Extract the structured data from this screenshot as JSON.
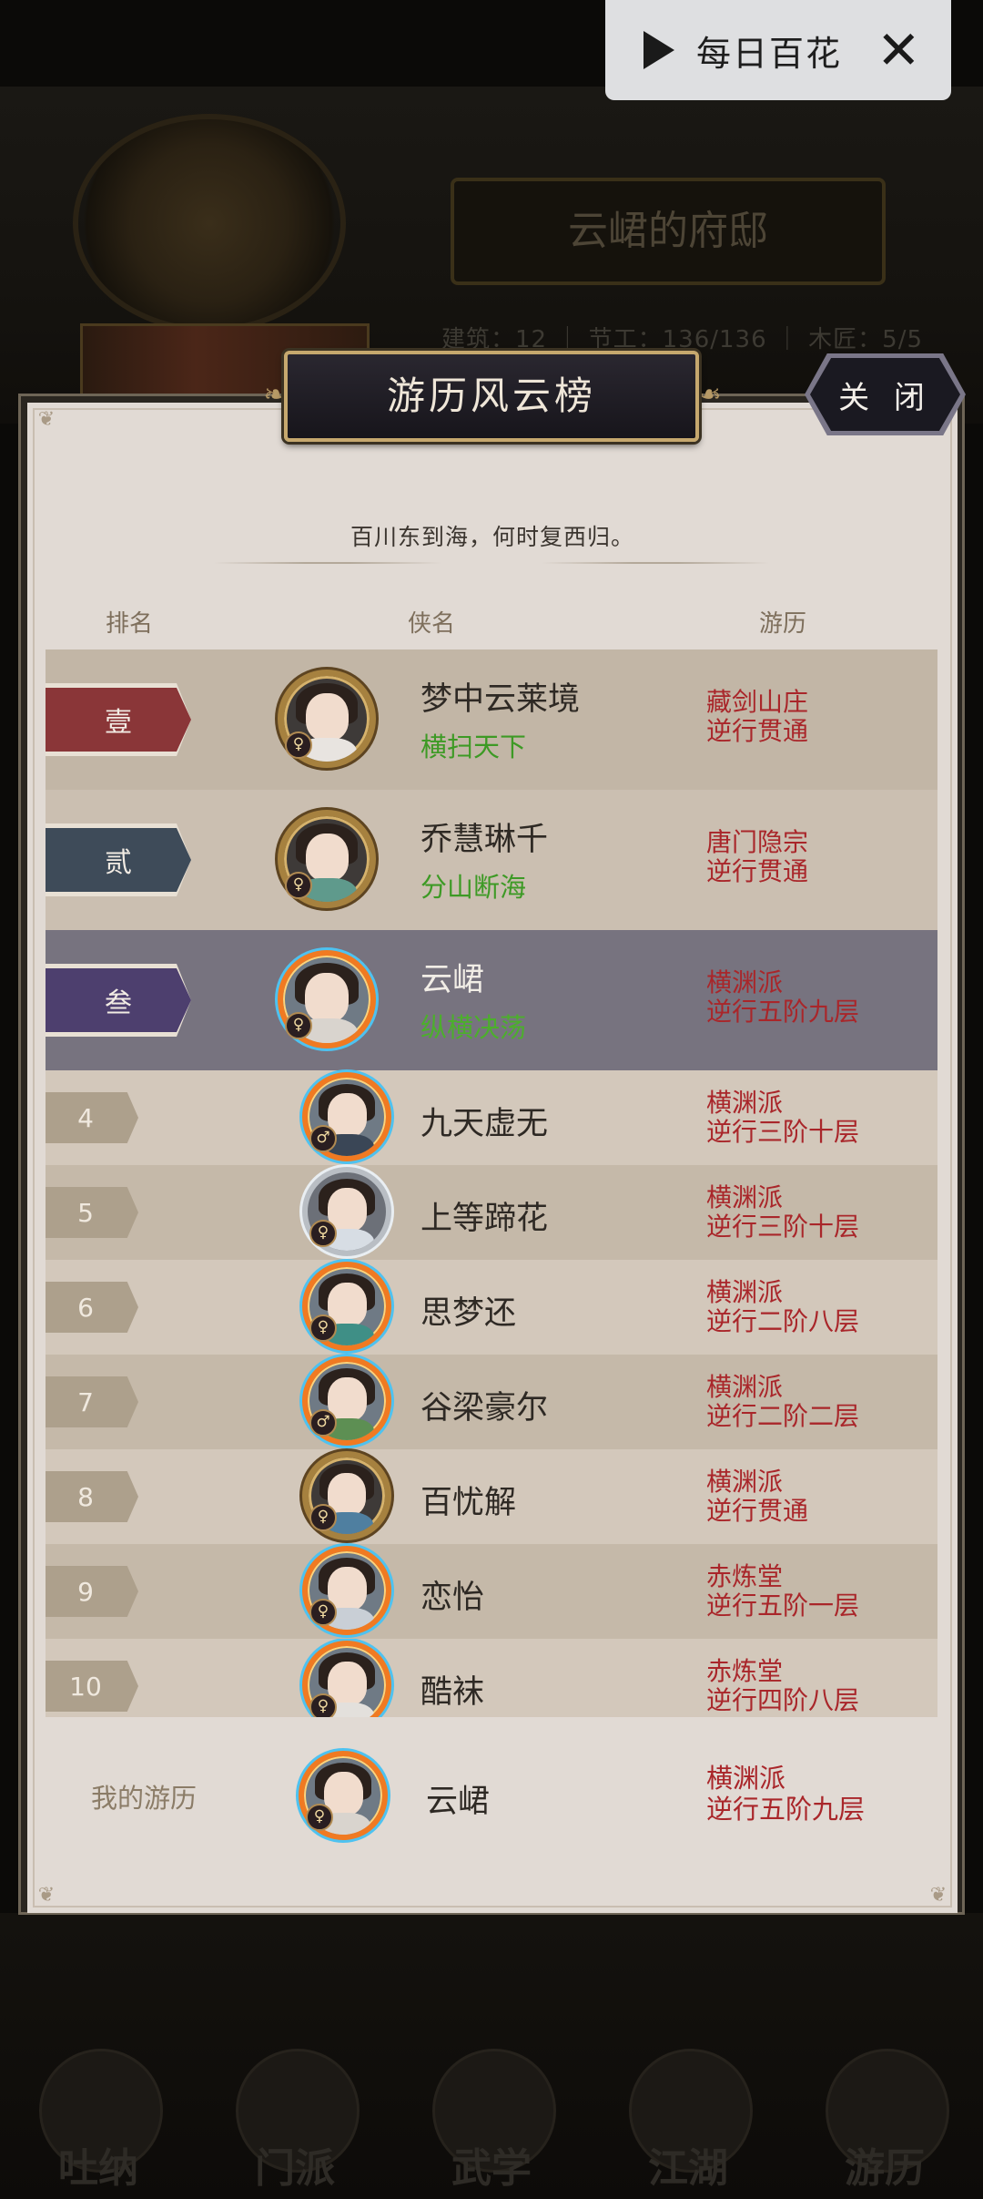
{
  "background": {
    "mansion_title": "云峮的府邸",
    "stats": "建筑：12 ｜ 节工：136/136 ｜ 木匠：5/5",
    "nav": [
      "吐纳",
      "门派",
      "武学",
      "江湖",
      "游历"
    ]
  },
  "daily": {
    "label": "每日百花"
  },
  "panel": {
    "title": "游历风云榜",
    "close_label": "关 闭",
    "subtitle": "百川东到海，何时复西归。",
    "columns": {
      "rank": "排名",
      "name": "侠名",
      "journey": "游历"
    }
  },
  "ranking": [
    {
      "rank": "壹",
      "name": "梦中云莱境",
      "title": "横扫天下",
      "sect": "藏剑山庄",
      "stage": "逆行贯通",
      "ribbon": "#8a3638"
    },
    {
      "rank": "贰",
      "name": "乔慧琳千",
      "title": "分山断海",
      "sect": "唐门隐宗",
      "stage": "逆行贯通",
      "ribbon": "#3e4b59"
    },
    {
      "rank": "叁",
      "name": "云峮",
      "title": "纵横决荡",
      "sect": "横渊派",
      "stage": "逆行五阶九层",
      "ribbon": "#4d3f6e"
    },
    {
      "rank": "4",
      "name": "九天虚无",
      "sect": "横渊派",
      "stage": "逆行三阶十层"
    },
    {
      "rank": "5",
      "name": "上等蹄花",
      "sect": "横渊派",
      "stage": "逆行三阶十层"
    },
    {
      "rank": "6",
      "name": "思梦还",
      "sect": "横渊派",
      "stage": "逆行二阶八层"
    },
    {
      "rank": "7",
      "name": "谷梁豪尔",
      "sect": "横渊派",
      "stage": "逆行二阶二层"
    },
    {
      "rank": "8",
      "name": "百忧解",
      "sect": "横渊派",
      "stage": "逆行贯通"
    },
    {
      "rank": "9",
      "name": "恋怡",
      "sect": "赤炼堂",
      "stage": "逆行五阶一层"
    },
    {
      "rank": "10",
      "name": "酷袜",
      "sect": "赤炼堂",
      "stage": "逆行四阶八层"
    }
  ],
  "my_record": {
    "label": "我的游历",
    "name": "云峮",
    "sect": "横渊派",
    "stage": "逆行五阶九层"
  }
}
